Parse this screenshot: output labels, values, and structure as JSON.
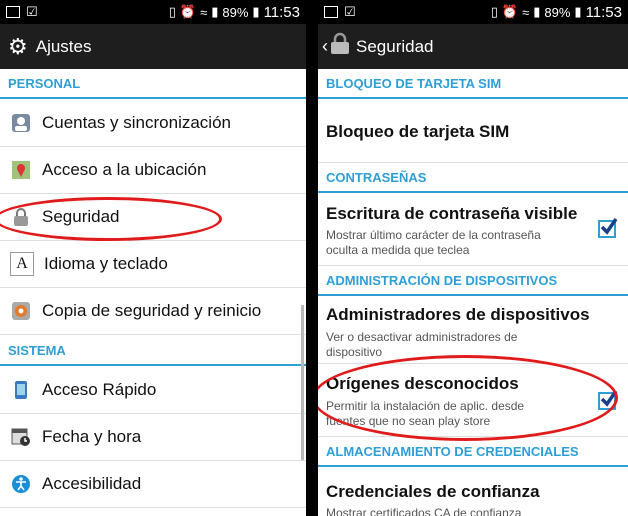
{
  "left_screen": {
    "status": {
      "battery": "89%",
      "time": "11:53"
    },
    "title": "Ajustes",
    "sections": [
      {
        "header": "PERSONAL"
      },
      {
        "header": "SISTEMA"
      }
    ],
    "items": [
      "Cuentas y sincronización",
      "Acceso a la ubicación",
      "Seguridad",
      "Idioma y teclado",
      "Copia de seguridad y reinicio",
      "Acceso Rápido",
      "Fecha y hora",
      "Accesibilidad"
    ]
  },
  "right_screen": {
    "status": {
      "battery": "89%",
      "time": "11:53"
    },
    "title": "Seguridad",
    "sections": [
      "BLOQUEO DE TARJETA SIM",
      "CONTRASEÑAS",
      "ADMINISTRACIÓN DE DISPOSITIVOS",
      "ALMACENAMIENTO DE CREDENCIALES"
    ],
    "items": {
      "sim_lock": {
        "title": "Bloqueo de tarjeta SIM"
      },
      "password_visible": {
        "title": "Escritura de contraseña visible",
        "summary": "Mostrar último carácter de la contraseña oculta a medida que teclea",
        "checked": true
      },
      "device_admins": {
        "title": "Administradores de dispositivos",
        "summary": "Ver o desactivar administradores de dispositivo"
      },
      "unknown_sources": {
        "title": "Orígenes desconocidos",
        "summary": "Permitir la instalación de aplic. desde fuentes que no sean play store",
        "checked": true
      },
      "trusted_credentials": {
        "title": "Credenciales de confianza",
        "summary": "Mostrar certificados CA de confianza"
      }
    }
  },
  "colors": {
    "accent": "#2e9fd6",
    "annotation": "#e11b1b"
  }
}
